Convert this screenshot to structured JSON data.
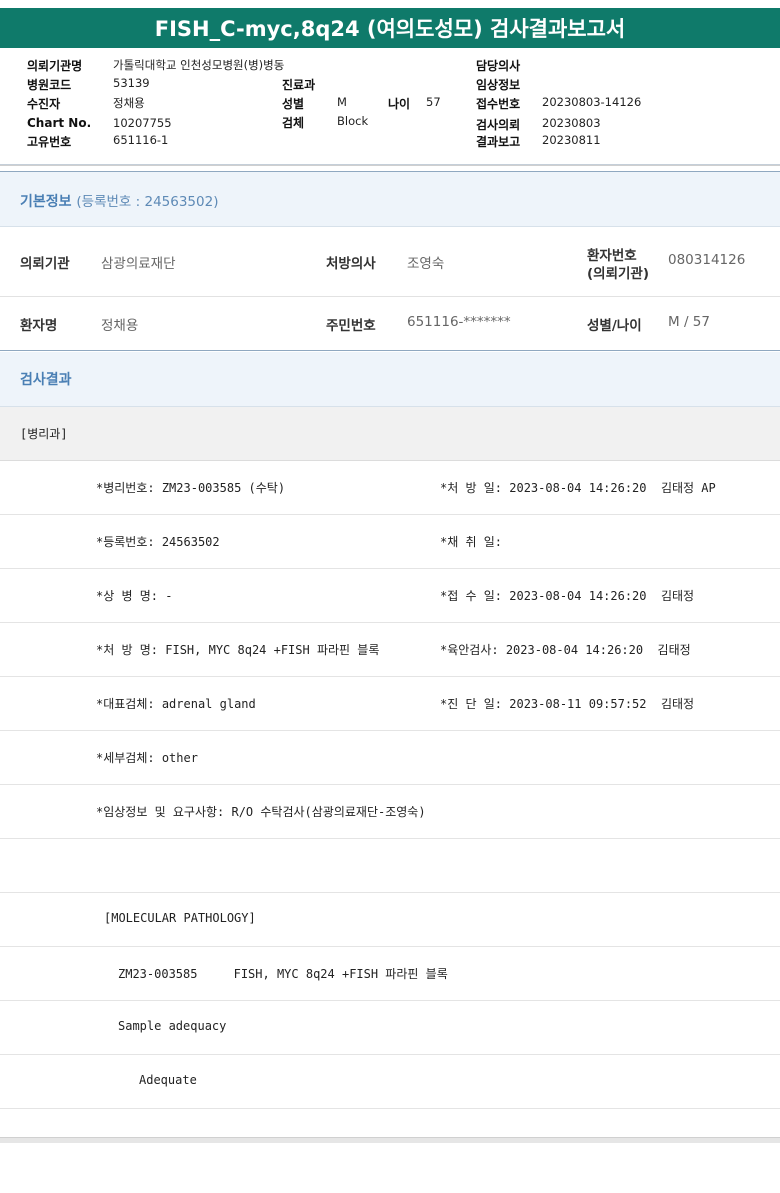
{
  "title": "FISH_C-myc,8q24 (여의도성모) 검사결과보고서",
  "header": {
    "col1": [
      {
        "label": "의뢰기관명",
        "value": "가톨릭대학교 인천성모병원(병)병동"
      },
      {
        "label": "병원코드",
        "value": "53139"
      },
      {
        "label": "수진자",
        "value": "정채용"
      },
      {
        "label": "Chart No.",
        "value": "10207755"
      },
      {
        "label": "고유번호",
        "value": "651116-1"
      }
    ],
    "col2": [
      {
        "label": "진료과",
        "value": ""
      },
      {
        "label": "성별",
        "value": "M"
      },
      {
        "label": "검체",
        "value": "Block"
      }
    ],
    "age": {
      "label": "나이",
      "value": "57"
    },
    "col3": [
      {
        "label": "담당의사",
        "value": ""
      },
      {
        "label": "임상정보",
        "value": ""
      },
      {
        "label": "접수번호",
        "value": "20230803-14126"
      },
      {
        "label": "검사의뢰",
        "value": "20230803"
      },
      {
        "label": "결과보고",
        "value": "20230811"
      }
    ]
  },
  "basic_info": {
    "title": "기본정보",
    "subtitle": "(등록번호 : 24563502)",
    "row1": {
      "org_label": "의뢰기관",
      "org_value": "삼광의료재단",
      "doctor_label": "처방의사",
      "doctor_value": "조영숙",
      "patno_label_1": "환자번호",
      "patno_label_2": "(의뢰기관)",
      "patno_value": "080314126"
    },
    "row2": {
      "name_label": "환자명",
      "name_value": "정채용",
      "rrn_label": "주민번호",
      "rrn_value": "651116-*******",
      "sexage_label": "성별/나이",
      "sexage_value": "M / 57"
    }
  },
  "results": {
    "title": "검사결과",
    "dept": "[병리과]",
    "rows": [
      {
        "left": "*병리번호: ZM23-003585 (수탁)",
        "right": "*처 방 일: 2023-08-04 14:26:20  김태정 AP"
      },
      {
        "left": "*등록번호: 24563502",
        "right": "*채 취 일:"
      },
      {
        "left": "*상 병 명: -",
        "right": "*접 수 일: 2023-08-04 14:26:20  김태정"
      },
      {
        "left": "*처 방 명: FISH, MYC 8q24 +FISH 파라핀 블록",
        "right": "*육안검사: 2023-08-04 14:26:20  김태정"
      },
      {
        "left": "*대표검체: adrenal gland",
        "right": "*진 단 일: 2023-08-11 09:57:52  김태정"
      },
      {
        "left": "*세부검체: other",
        "right": ""
      },
      {
        "left": "*임상정보 및 요구사항: R/O 수탁검사(삼광의료재단-조영숙)",
        "right": ""
      },
      {
        "left": "",
        "right": ""
      }
    ],
    "molecular": [
      {
        "text": "[MOLECULAR PATHOLOGY]",
        "indent": 104
      },
      {
        "text": "ZM23-003585     FISH, MYC 8q24 +FISH 파라핀 블록",
        "indent": 118
      },
      {
        "text": "Sample adequacy",
        "indent": 118
      },
      {
        "text": "Adequate",
        "indent": 139
      }
    ]
  },
  "colors": {
    "title_bg": "#0f7a6a",
    "section_title": "#4a7fb4",
    "section_bg": "#eef4fa"
  }
}
